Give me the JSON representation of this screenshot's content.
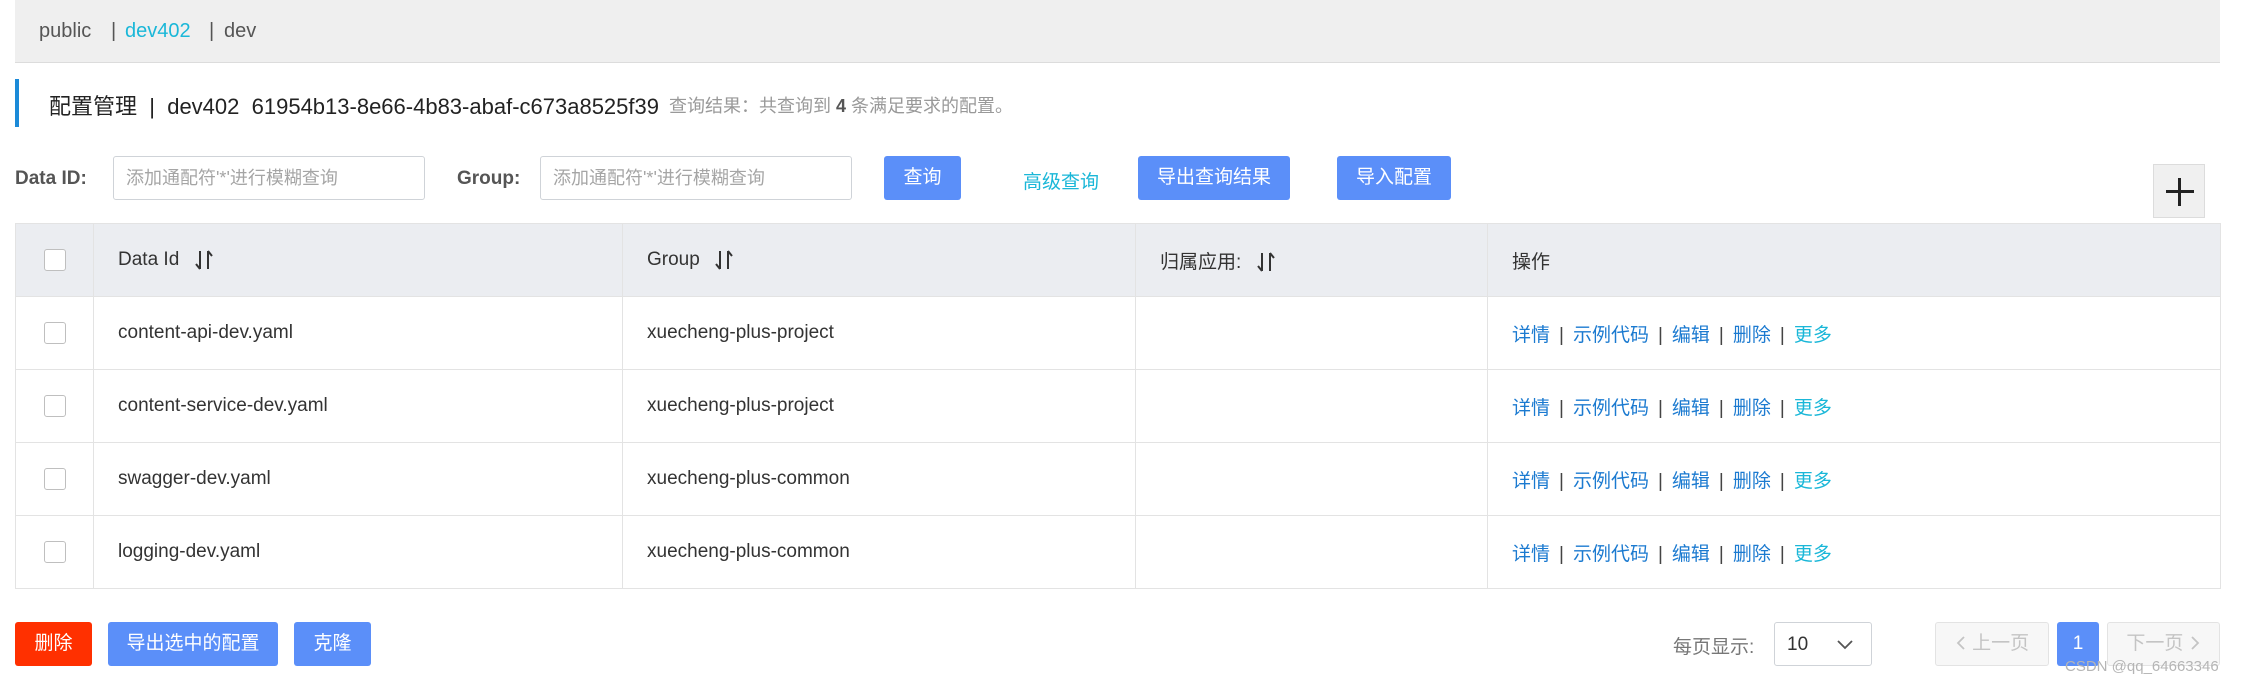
{
  "namespaces": {
    "items": [
      {
        "label": "public"
      },
      {
        "label": "dev402"
      },
      {
        "label": "dev"
      }
    ],
    "separator": "|"
  },
  "header": {
    "title": "配置管理",
    "separator": "|",
    "namespace_name": "dev402",
    "namespace_id": "61954b13-8e66-4b83-abaf-c673a8525f39",
    "result_prefix": "查询结果：共查询到",
    "result_count": "4",
    "result_suffix": "条满足要求的配置。"
  },
  "search": {
    "data_id_label": "Data ID:",
    "data_id_placeholder": "添加通配符'*'进行模糊查询",
    "group_label": "Group:",
    "group_placeholder": "添加通配符'*'进行模糊查询",
    "query_button": "查询",
    "advanced_query": "高级查询",
    "export_results_button": "导出查询结果",
    "import_button": "导入配置"
  },
  "table": {
    "columns": [
      "Data Id",
      "Group",
      "归属应用:",
      "操作"
    ],
    "rows": [
      {
        "data_id": "content-api-dev.yaml",
        "group": "xuecheng-plus-project",
        "app": ""
      },
      {
        "data_id": "content-service-dev.yaml",
        "group": "xuecheng-plus-project",
        "app": ""
      },
      {
        "data_id": "swagger-dev.yaml",
        "group": "xuecheng-plus-common",
        "app": ""
      },
      {
        "data_id": "logging-dev.yaml",
        "group": "xuecheng-plus-common",
        "app": ""
      }
    ],
    "actions": {
      "detail": "详情",
      "sample_code": "示例代码",
      "edit": "编辑",
      "delete": "删除",
      "more": "更多",
      "separator": "|"
    }
  },
  "footer": {
    "delete_button": "删除",
    "export_selected_button": "导出选中的配置",
    "clone_button": "克隆",
    "page_size_label": "每页显示:",
    "page_size_value": "10",
    "prev_page": "上一页",
    "current_page": "1",
    "next_page": "下一页"
  },
  "watermark": "CSDN @qq_64663346",
  "colors": {
    "primary": "#5b8ff9",
    "danger": "#ff3000",
    "link": "#1b7ad0",
    "active_namespace": "#1ab7d8"
  }
}
